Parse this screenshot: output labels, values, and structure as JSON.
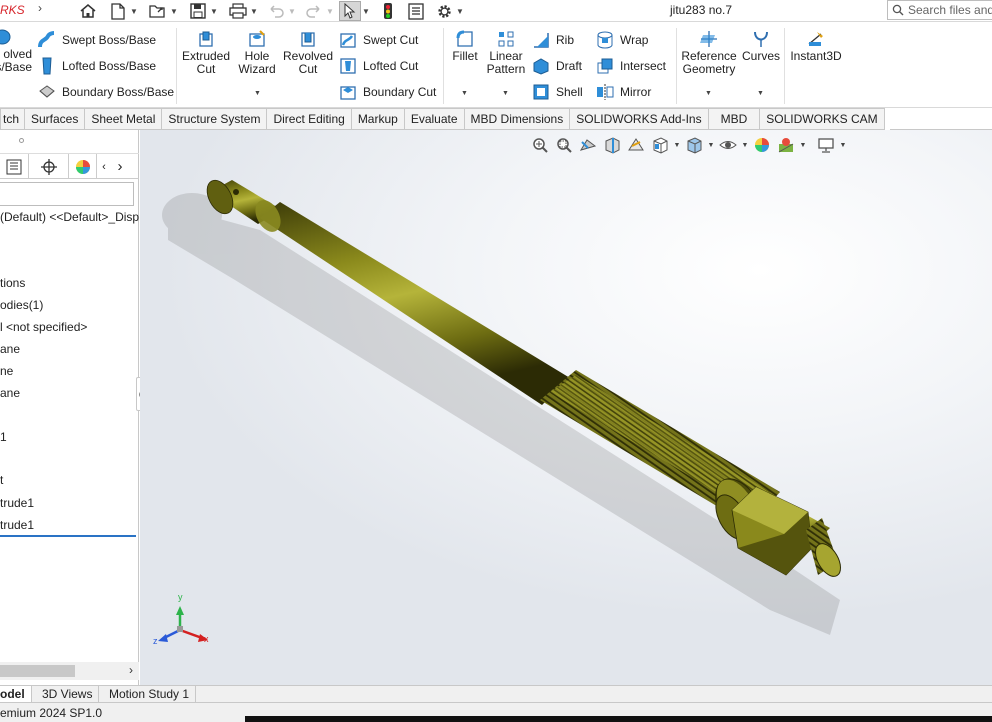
{
  "titlebar": {
    "brand": "RKS",
    "doc_title": "jitu283 no.7",
    "search_placeholder": "Search files and"
  },
  "ribbon": {
    "boss_group": {
      "revolved_label": "olved\ns/Base",
      "swept_boss": "Swept Boss/Base",
      "lofted_boss": "Lofted Boss/Base",
      "boundary_boss": "Boundary Boss/Base"
    },
    "cut_group": {
      "extruded_cut": "Extruded\nCut",
      "hole_wizard": "Hole\nWizard",
      "revolved_cut": "Revolved\nCut",
      "swept_cut": "Swept Cut",
      "lofted_cut": "Lofted Cut",
      "boundary_cut": "Boundary Cut"
    },
    "features_group": {
      "fillet": "Fillet",
      "linear_pattern": "Linear\nPattern",
      "rib": "Rib",
      "draft": "Draft",
      "shell": "Shell",
      "wrap": "Wrap",
      "intersect": "Intersect",
      "mirror": "Mirror"
    },
    "ref_group": {
      "reference_geometry": "Reference\nGeometry",
      "curves": "Curves",
      "instant3d": "Instant3D"
    }
  },
  "tabs": [
    "tch",
    "Surfaces",
    "Sheet Metal",
    "Structure System",
    "Direct Editing",
    "Markup",
    "Evaluate",
    "MBD Dimensions",
    "SOLIDWORKS Add-Ins",
    "MBD",
    "SOLIDWORKS CAM"
  ],
  "tree": {
    "items": [
      "(Default) <<Default>_Disp",
      "tions",
      "odies(1)",
      "l <not specified>",
      "ane",
      "ne",
      "ane",
      "1",
      "t",
      "trude1",
      "trude1"
    ]
  },
  "triad": {
    "x": "x",
    "y": "y",
    "z": "z"
  },
  "bottom_tabs": [
    "odel",
    "3D Views",
    "Motion Study 1"
  ],
  "status": "emium 2024 SP1.0"
}
